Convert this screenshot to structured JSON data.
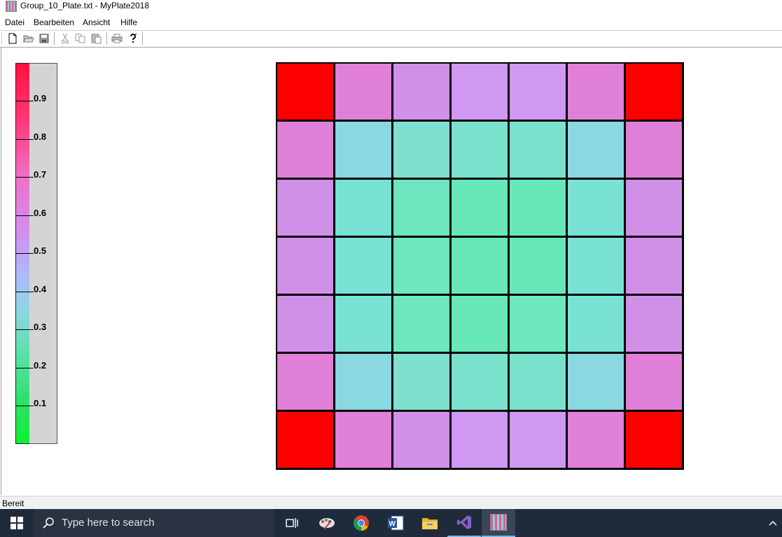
{
  "window": {
    "title": "Group_10_Plate.txt - MyPlate2018",
    "icon": "plate-app-icon"
  },
  "menu": [
    "Datei",
    "Bearbeiten",
    "Ansicht",
    "Hilfe"
  ],
  "toolbar": {
    "icons": [
      "new-icon",
      "open-icon",
      "save-icon",
      "cut-icon",
      "copy-icon",
      "paste-icon",
      "print-icon",
      "help-icon"
    ]
  },
  "legend": {
    "labels": [
      "0.9",
      "0.8",
      "0.7",
      "0.6",
      "0.5",
      "0.4",
      "0.3",
      "0.2",
      "0.1"
    ],
    "colors": {
      "top": "#ff1040",
      "bottom": "#10f030"
    }
  },
  "plate": {
    "rows": 7,
    "cols": 7,
    "wells": [
      [
        "#ff0000",
        "#e080d8",
        "#d090e8",
        "#d098f0",
        "#d098f0",
        "#e080d8",
        "#ff0000"
      ],
      [
        "#e080d8",
        "#8ad8e0",
        "#80e0d0",
        "#7ae2cc",
        "#7ae2cc",
        "#8ad8e0",
        "#e080d8"
      ],
      [
        "#d090e8",
        "#78e2d4",
        "#6ee6c0",
        "#68e8b8",
        "#68e8b8",
        "#78e2d4",
        "#d090e8"
      ],
      [
        "#d090e8",
        "#78e2d4",
        "#6ee6c0",
        "#68e8b8",
        "#68e8b8",
        "#78e2d4",
        "#d090e8"
      ],
      [
        "#d090e8",
        "#78e2d4",
        "#6ee6c0",
        "#68e8b8",
        "#6ee6c0",
        "#78e2d4",
        "#d090e8"
      ],
      [
        "#e080d8",
        "#8ad8e0",
        "#80e0d0",
        "#7ae2cc",
        "#7ae2cc",
        "#8ad8e0",
        "#e080d8"
      ],
      [
        "#ff0000",
        "#e080d8",
        "#d090e8",
        "#d098f0",
        "#d098f0",
        "#e080d8",
        "#ff0000"
      ]
    ]
  },
  "status": {
    "text": "Bereit"
  },
  "taskbar": {
    "search_placeholder": "Type here to search",
    "apps": [
      "task-view-icon",
      "paint-icon",
      "chrome-icon",
      "word-icon",
      "file-explorer-icon",
      "visual-studio-icon",
      "myplate-icon"
    ]
  }
}
